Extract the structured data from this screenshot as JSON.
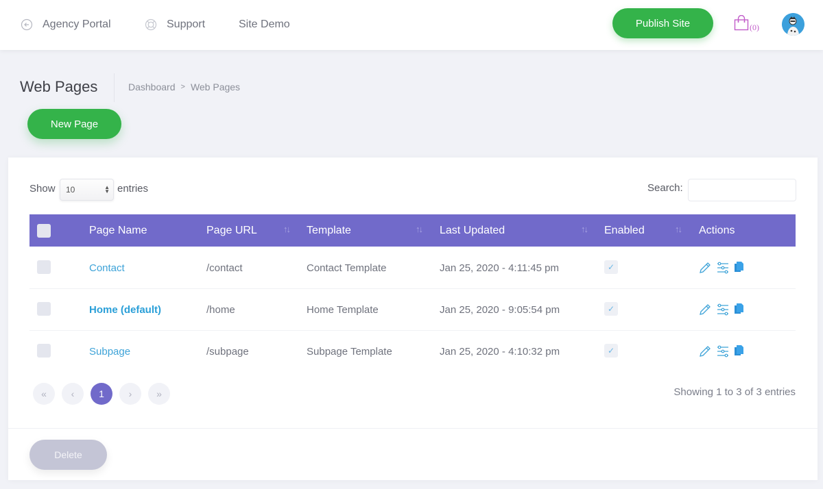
{
  "topbar": {
    "nav": [
      {
        "label": "Agency Portal",
        "icon": "arrow-left-circle-icon"
      },
      {
        "label": "Support",
        "icon": "lifebuoy-icon"
      },
      {
        "label": "Site Demo",
        "icon": ""
      }
    ],
    "publish_label": "Publish Site",
    "cart_count": "(0)",
    "colors": {
      "accent_green": "#34b34a",
      "cart": "#c15cc9"
    }
  },
  "header": {
    "title": "Web Pages",
    "breadcrumb": [
      "Dashboard",
      "Web Pages"
    ],
    "breadcrumb_sep": ">",
    "new_page_label": "New Page"
  },
  "table_controls": {
    "show_label": "Show",
    "length_value": "10",
    "entries_label": "entries",
    "search_label": "Search:",
    "search_value": ""
  },
  "table": {
    "header_color": "#716aca",
    "columns": [
      "Page Name",
      "Page URL",
      "Template",
      "Last Updated",
      "Enabled",
      "Actions"
    ],
    "rows": [
      {
        "name": "Contact",
        "url": "/contact",
        "template": "Contact Template",
        "updated": "Jan 25, 2020 - 4:11:45 pm",
        "enabled": true,
        "default": false
      },
      {
        "name": "Home (default)",
        "url": "/home",
        "template": "Home Template",
        "updated": "Jan 25, 2020 - 9:05:54 pm",
        "enabled": true,
        "default": true
      },
      {
        "name": "Subpage",
        "url": "/subpage",
        "template": "Subpage Template",
        "updated": "Jan 25, 2020 - 4:10:32 pm",
        "enabled": true,
        "default": false
      }
    ],
    "check_glyph": "✓"
  },
  "pagination": {
    "first": "«",
    "prev": "‹",
    "current": "1",
    "next": "›",
    "last": "»",
    "info": "Showing 1 to 3 of 3 entries"
  },
  "footer": {
    "delete_label": "Delete"
  }
}
